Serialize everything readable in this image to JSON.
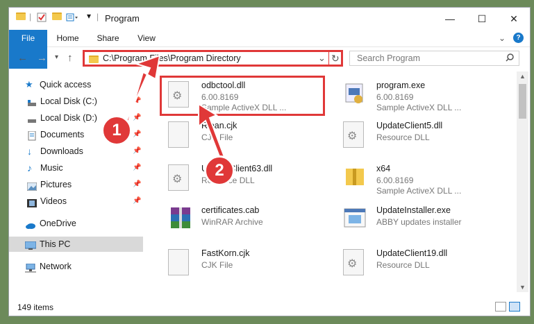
{
  "window": {
    "title": "Program",
    "controls": {
      "minimize": "—",
      "maximize": "☐",
      "close": "✕"
    }
  },
  "ribbon": {
    "tabs": [
      "File",
      "Home",
      "Share",
      "View"
    ],
    "collapse": "⌄",
    "help": "?"
  },
  "address": {
    "path": "C:\\Program Files\\Program Directory",
    "dropdown": "⌄",
    "refresh": "↻"
  },
  "search": {
    "placeholder": "Search Program",
    "icon": "⚲"
  },
  "sidebar": {
    "quick_access": "Quick access",
    "items": [
      {
        "label": "Local Disk (C:)",
        "icon": "drive-icon",
        "pinned": true
      },
      {
        "label": "Local Disk (D:)",
        "icon": "drive-icon",
        "pinned": true
      },
      {
        "label": "Documents",
        "icon": "documents-icon",
        "pinned": true
      },
      {
        "label": "Downloads",
        "icon": "download-icon",
        "pinned": true
      },
      {
        "label": "Music",
        "icon": "music-icon",
        "pinned": true
      },
      {
        "label": "Pictures",
        "icon": "pictures-icon",
        "pinned": true
      },
      {
        "label": "Videos",
        "icon": "videos-icon",
        "pinned": true
      }
    ],
    "onedrive": "OneDrive",
    "this_pc": "This PC",
    "network": "Network"
  },
  "files": [
    {
      "name": "odbctool.dll",
      "line2": "6.00.8169",
      "line3": "Sample ActiveX DLL ...",
      "icon": "dll-gear-icon"
    },
    {
      "name": "program.exe",
      "line2": "6.00.8169",
      "line3": "Sample ActiveX DLL ...",
      "icon": "exe-icon"
    },
    {
      "name": "Riean.cjk",
      "line2": "CJK File",
      "line3": "",
      "icon": "blank-file-icon"
    },
    {
      "name": "UpdateClient5.dll",
      "line2": "Resource DLL",
      "line3": "",
      "icon": "dll-gear-icon"
    },
    {
      "name": "UpdateClient63.dll",
      "line2": "Resource DLL",
      "line3": "",
      "icon": "dll-gear-icon"
    },
    {
      "name": "x64",
      "line2": "6.00.8169",
      "line3": "Sample ActiveX DLL ...",
      "icon": "zip-folder-icon"
    },
    {
      "name": "certificates.cab",
      "line2": "WinRAR Archive",
      "line3": "",
      "icon": "winrar-icon"
    },
    {
      "name": "UpdateInstaller.exe",
      "line2": "ABBY updates installer",
      "line3": "",
      "icon": "installer-icon"
    },
    {
      "name": "FastKorn.cjk",
      "line2": "CJK File",
      "line3": "",
      "icon": "blank-file-icon"
    },
    {
      "name": "UpdateClient19.dll",
      "line2": "Resource DLL",
      "line3": "",
      "icon": "dll-gear-icon"
    }
  ],
  "status": {
    "count": "149 items"
  },
  "annotations": {
    "step1": "1",
    "step2": "2"
  },
  "colors": {
    "accent": "#1979ca",
    "highlight": "#e03838",
    "selected": "#d9d9d9"
  }
}
